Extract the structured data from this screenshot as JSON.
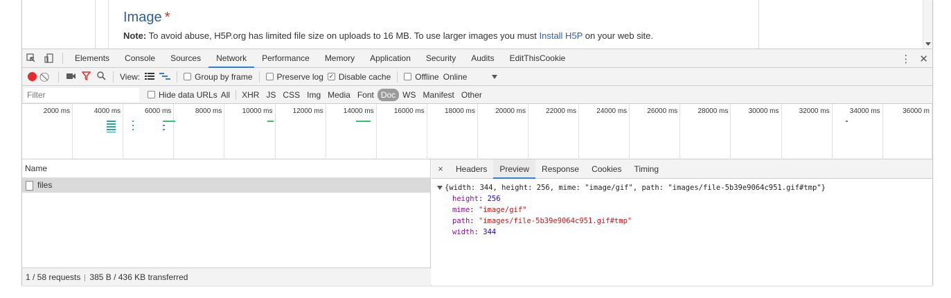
{
  "page": {
    "field_label": "Image",
    "required_mark": "*",
    "note_prefix": "Note:",
    "note_text": " To avoid abuse, H5P.org has limited file size on uploads to 16 MB. To use larger images you must ",
    "note_link": "Install H5P",
    "note_suffix": " on your web site."
  },
  "devtools": {
    "tabs": [
      "Elements",
      "Console",
      "Sources",
      "Network",
      "Performance",
      "Memory",
      "Application",
      "Security",
      "Audits",
      "EditThisCookie"
    ],
    "active_tab": "Network"
  },
  "toolbar": {
    "view_label": "View:",
    "group_by_frame": "Group by frame",
    "preserve_log": "Preserve log",
    "disable_cache": "Disable cache",
    "offline": "Offline",
    "throttle_value": "Online"
  },
  "filter": {
    "placeholder": "Filter",
    "hide_data_urls": "Hide data URLs",
    "types": [
      "All",
      "XHR",
      "JS",
      "CSS",
      "Img",
      "Media",
      "Font",
      "Doc",
      "WS",
      "Manifest",
      "Other"
    ],
    "active_type": "Doc"
  },
  "timeline": {
    "ticks": [
      "2000 ms",
      "4000 ms",
      "6000 ms",
      "8000 ms",
      "10000 ms",
      "12000 ms",
      "14000 ms",
      "16000 ms",
      "18000 ms",
      "20000 ms",
      "22000 ms",
      "24000 ms",
      "26000 ms",
      "28000 ms",
      "30000 ms",
      "32000 ms",
      "34000 ms",
      "36000 m"
    ]
  },
  "requests": {
    "column_name": "Name",
    "rows": [
      {
        "name": "files"
      }
    ],
    "status_requests": "1 / 58 requests",
    "status_transferred": "385 B / 436 KB transferred"
  },
  "details": {
    "close": "×",
    "tabs": [
      "Headers",
      "Preview",
      "Response",
      "Cookies",
      "Timing"
    ],
    "active_tab": "Preview",
    "summary": "{width: 344, height: 256, mime: \"image/gif\", path: \"images/file-5b39e9064c951.gif#tmp\"}",
    "props": [
      {
        "key": "height",
        "value": "256",
        "kind": "number"
      },
      {
        "key": "mime",
        "value": "\"image/gif\"",
        "kind": "string"
      },
      {
        "key": "path",
        "value": "\"images/file-5b39e9064c951.gif#tmp\"",
        "kind": "string"
      },
      {
        "key": "width",
        "value": "344",
        "kind": "number"
      }
    ]
  },
  "colors": {
    "record": "#e52b2b",
    "active_tab_underline": "#3879d9",
    "waterfall": "#26a69a"
  }
}
